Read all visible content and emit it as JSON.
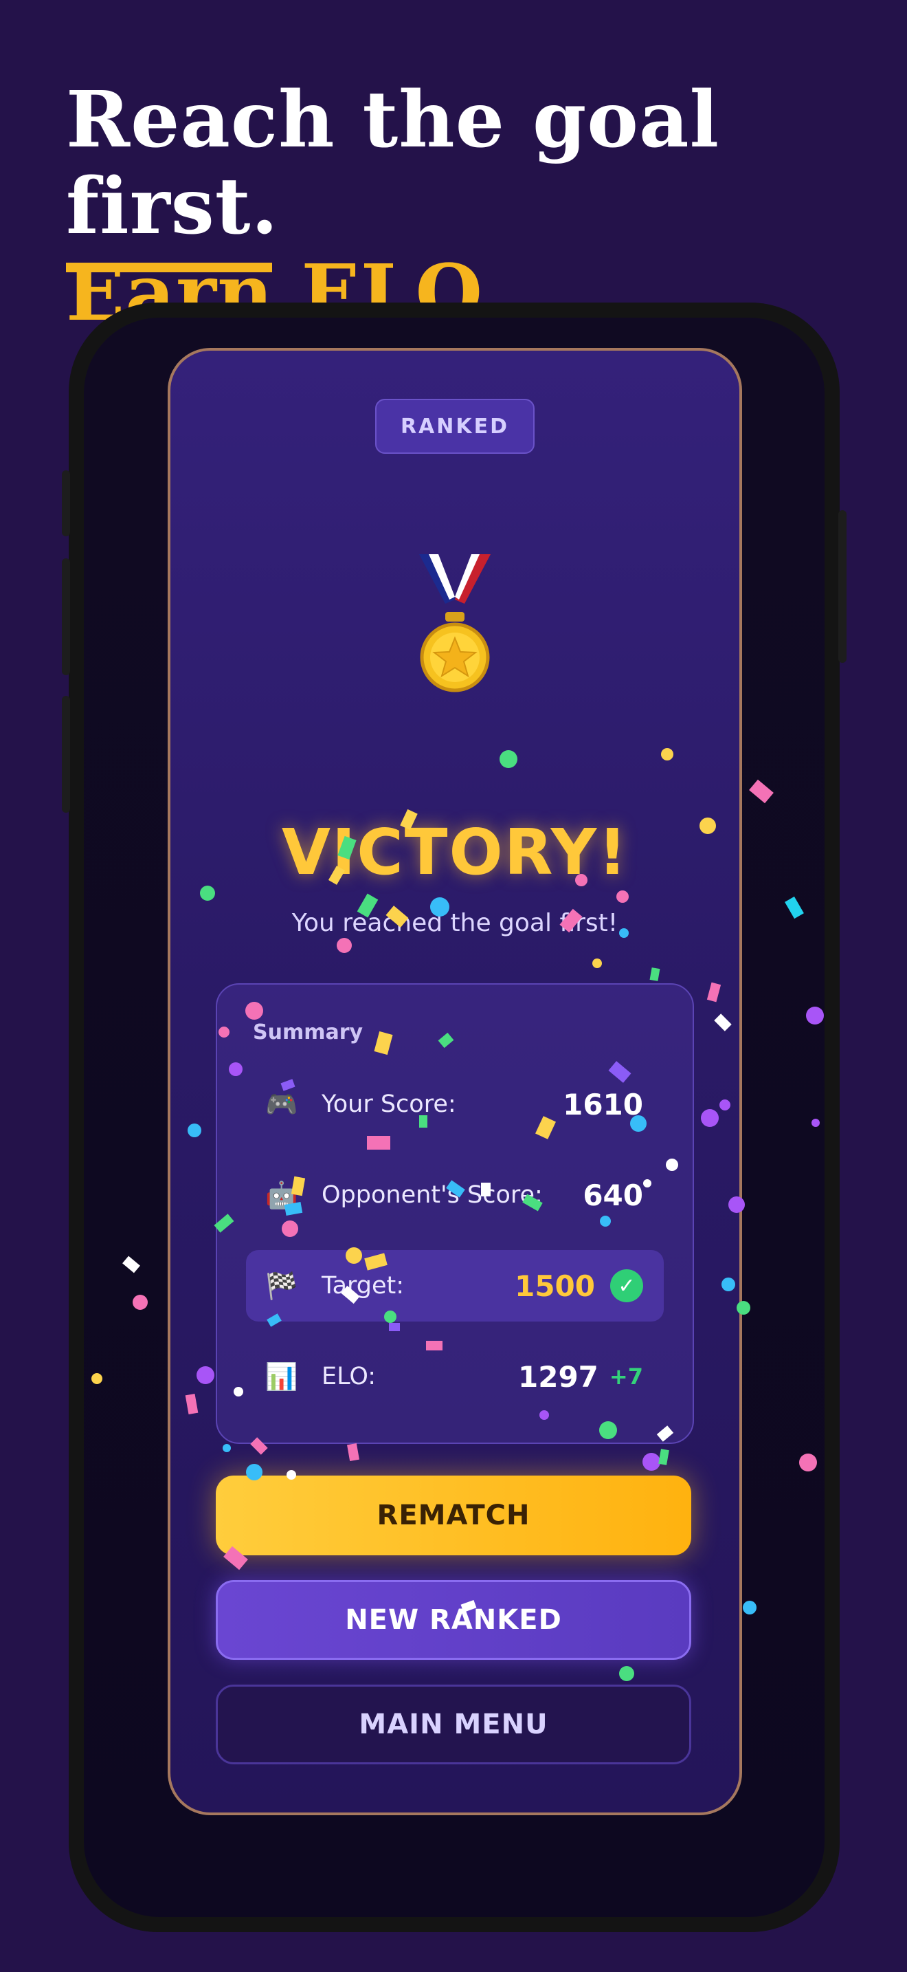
{
  "headline": {
    "line1": "Reach the goal first.",
    "line2": "Earn ELO."
  },
  "screen": {
    "badge": "RANKED",
    "medal_icon": "medal-icon",
    "title": "VICTORY!",
    "subtitle": "You reached the goal first!",
    "summary": {
      "title": "Summary",
      "rows": [
        {
          "icon": "🎮",
          "icon_name": "gamepad-icon",
          "label": "Your Score:",
          "value": "1610"
        },
        {
          "icon": "🤖",
          "icon_name": "robot-icon",
          "label": "Opponent's Score:",
          "value": "640"
        },
        {
          "icon": "🏁",
          "icon_name": "checkered-flag-icon",
          "label": "Target:",
          "value": "1500",
          "check": "✓"
        },
        {
          "icon": "📊",
          "icon_name": "bar-chart-icon",
          "label": "ELO:",
          "value": "1297",
          "delta": "+7"
        }
      ]
    },
    "buttons": {
      "rematch": "REMATCH",
      "new_ranked": "NEW RANKED",
      "main_menu": "MAIN MENU"
    }
  },
  "colors": {
    "background": "#24124a",
    "accent_gold": "#f6b51e",
    "victory": "#ffc83a",
    "success": "#2fcf76",
    "purple": "#5a3bc0"
  }
}
